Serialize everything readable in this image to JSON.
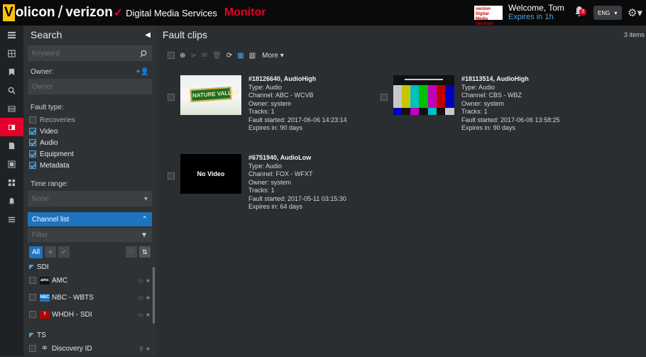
{
  "header": {
    "logo_v": "V",
    "logo_olicon": "olicon",
    "logo_slash": "/",
    "logo_verizon": "verizon",
    "logo_check": "✓",
    "logo_dms": "Digital Media Services",
    "app_name": "Monitor",
    "badge_text": "verizon Digital Media Services",
    "welcome": "Welcome, Tom",
    "expires": "Expires in 1h",
    "notification_count": "3",
    "language": "ENG",
    "accent_color": "#e4002b",
    "brand_yellow": "#ffc20e"
  },
  "sidebar": {
    "title": "Search",
    "keyword_placeholder": "Keyword",
    "owner_label": "Owner:",
    "owner_placeholder": "Owner",
    "fault_type_label": "Fault type:",
    "fault_types": [
      {
        "label": "Recoveries",
        "checked": false
      },
      {
        "label": "Video",
        "checked": true
      },
      {
        "label": "Audio",
        "checked": true
      },
      {
        "label": "Equipment",
        "checked": true
      },
      {
        "label": "Metadata",
        "checked": true
      }
    ],
    "time_range_label": "Time range:",
    "time_range_value": "None",
    "channel_list_label": "Channel list",
    "filter_placeholder": "Filter",
    "all_label": "All",
    "groups": [
      {
        "name": "SDI",
        "channels": [
          {
            "logo": "amc",
            "name": "AMC"
          },
          {
            "logo": "NBC",
            "name": "NBC - WBTS"
          },
          {
            "logo": "7",
            "name": "WHDH - SDI"
          }
        ]
      },
      {
        "name": "TS",
        "channels": [
          {
            "logo": "ID",
            "name": "Discovery ID"
          }
        ]
      }
    ]
  },
  "main": {
    "title": "Fault clips",
    "count": "3 items",
    "more_label": "More",
    "clips": [
      {
        "title": "#18126640, AudioHigh",
        "type": "Type: Audio",
        "channel": "Channel: ABC - WCVB",
        "owner": "Owner: system",
        "tracks": "Tracks: 1",
        "started": "Fault started: 2017-06-06 14:23:14",
        "expires": "Expires in: 90 days",
        "thumb_text": "NATURE VALLEY"
      },
      {
        "title": "#18113514, AudioHigh",
        "type": "Type: Audio",
        "channel": "Channel: CBS - WBZ",
        "owner": "Owner: system",
        "tracks": "Tracks: 1",
        "started": "Fault started: 2017-06-06 13:58:25",
        "expires": "Expires in: 90 days",
        "thumb_text": ""
      },
      {
        "title": "#6751940, AudioLow",
        "type": "Type: Audio",
        "channel": "Channel: FOX - WFXT",
        "owner": "Owner: system",
        "tracks": "Tracks: 1",
        "started": "Fault started: 2017-05-11 03:15:30",
        "expires": "Expires in: 64 days",
        "thumb_text": "No Video"
      }
    ]
  }
}
